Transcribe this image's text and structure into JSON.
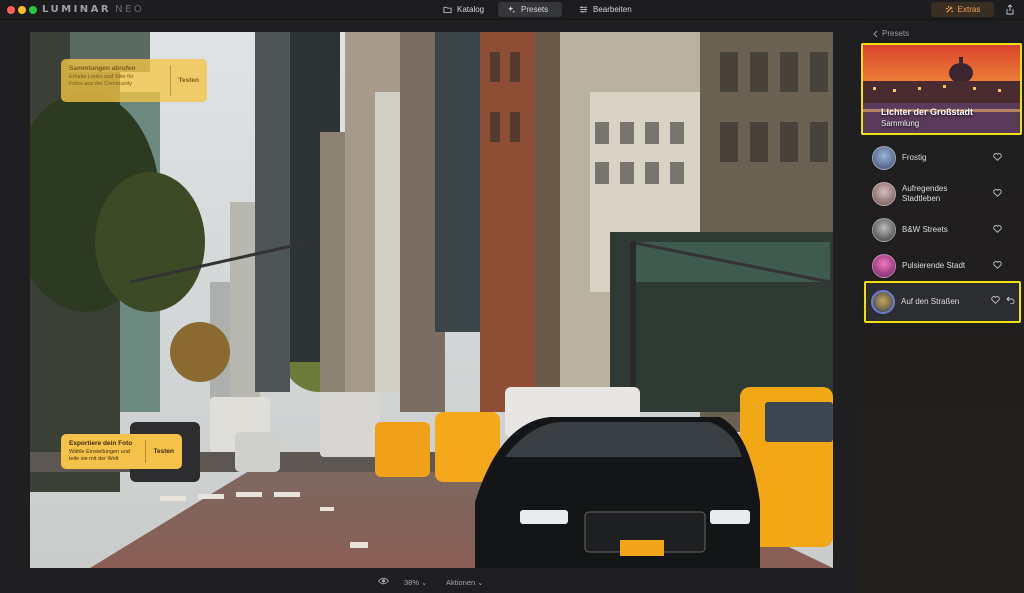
{
  "app": {
    "logo": "LUMINAR",
    "logo_suffix": "NEO"
  },
  "nav": {
    "katalog": "Katalog",
    "presets": "Presets",
    "bearbeiten": "Bearbeiten",
    "extras": "Extras"
  },
  "tips": {
    "top": {
      "title": "Sammlungen abrufen",
      "text": "Erhalte Looks und Stile für Fotos aus der Community",
      "button": "Testen"
    },
    "bottom": {
      "title": "Exportiere dein Foto",
      "text": "Wähle Einstellungen und teile sie mit der Welt",
      "button": "Testen"
    }
  },
  "bottombar": {
    "zoom": "38%",
    "actions": "Aktionen"
  },
  "panel": {
    "back": "Presets",
    "collection": {
      "title": "Lichter der Großstadt",
      "subtitle": "Sammlung"
    },
    "presets": [
      {
        "label": "Frostig"
      },
      {
        "label": "Aufregendes Stadtleben"
      },
      {
        "label": "B&W Streets"
      },
      {
        "label": "Pulsierende Stadt"
      },
      {
        "label": "Auf den Straßen",
        "selected": true
      }
    ]
  },
  "colors": {
    "highlight": "#f0e10d",
    "extras_accent": "#f0a35a",
    "tip_yellow": "#f4c14a"
  }
}
